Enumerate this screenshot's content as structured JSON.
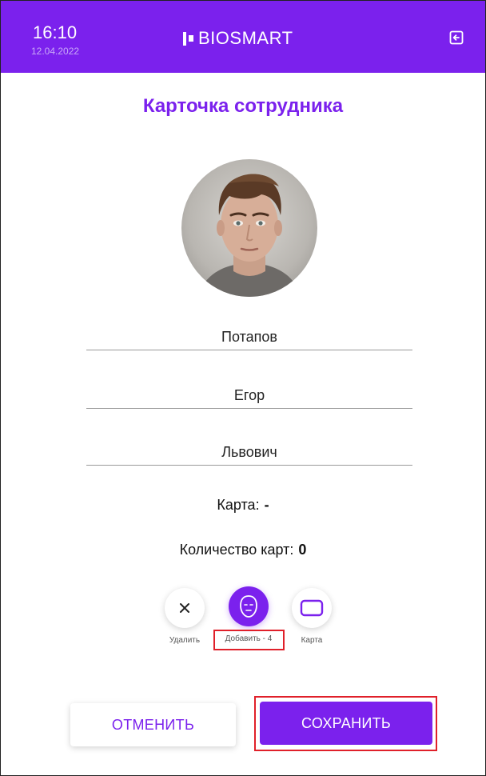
{
  "header": {
    "time": "16:10",
    "date": "12.04.2022",
    "logo": "BIOSMART",
    "exit_icon": "exit-icon",
    "background_color": "#7b21ed"
  },
  "page_title": "Карточка сотрудника",
  "employee": {
    "last_name": "Потапов",
    "first_name": "Егор",
    "patronymic": "Львович"
  },
  "card": {
    "label": "Карта:",
    "value": "-"
  },
  "card_count": {
    "label": "Количество карт:",
    "value": "0"
  },
  "actions": [
    {
      "label": "Удалить",
      "icon": "close-icon"
    },
    {
      "label": "Добавить - 4",
      "icon": "face-icon"
    },
    {
      "label": "Карта",
      "icon": "card-icon"
    }
  ],
  "buttons": {
    "cancel": "ОТМЕНИТЬ",
    "save": "СОХРАНИТЬ"
  },
  "colors": {
    "accent": "#7b21ed",
    "highlight": "#e0202a"
  }
}
